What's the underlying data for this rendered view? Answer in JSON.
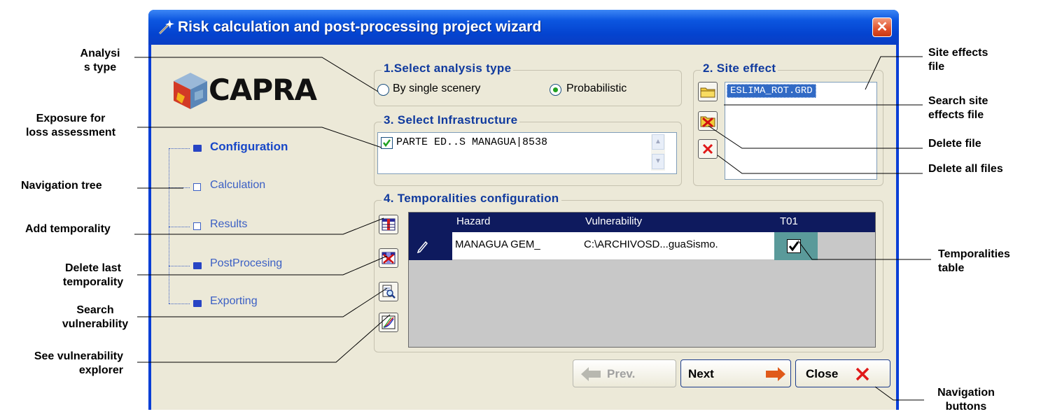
{
  "window": {
    "title": "Risk calculation and post-processing project wizard",
    "close_glyph": "✕"
  },
  "logo": {
    "text": "CAPRA"
  },
  "nav_tree": {
    "items": [
      {
        "label": "Configuration",
        "state": "active"
      },
      {
        "label": "Calculation",
        "state": "empty"
      },
      {
        "label": "Results",
        "state": "empty"
      },
      {
        "label": "PostProcesing",
        "state": "filled"
      },
      {
        "label": "Exporting",
        "state": "filled"
      }
    ]
  },
  "analysis": {
    "legend": "1.Select analysis type",
    "options": [
      {
        "label": "By single scenery",
        "selected": false
      },
      {
        "label": "Probabilistic",
        "selected": true
      }
    ]
  },
  "site_effect": {
    "legend": "2. Site effect",
    "files": [
      "ESLIMA_ROT.GRD"
    ]
  },
  "infrastructure": {
    "legend": "3. Select Infrastructure",
    "items": [
      {
        "label": "PARTE ED..S MANAGUA|8538",
        "checked": true
      }
    ]
  },
  "temporalities": {
    "legend": "4. Temporalities configuration",
    "columns": [
      "Hazard",
      "Vulnerability",
      "T01"
    ],
    "rows": [
      {
        "hazard": "MANAGUA GEM_",
        "vulnerability": "C:\\ARCHIVOSD...guaSismo.",
        "t01": true
      }
    ]
  },
  "nav_buttons": {
    "prev": "Prev.",
    "next": "Next",
    "close": "Close"
  },
  "callouts": {
    "analysis_type": "Analysi\ns type",
    "exposure": "Exposure for\nloss assessment",
    "navigation_tree": "Navigation tree",
    "add_temporality": "Add temporality",
    "delete_last": "Delete last\ntemporality",
    "search_vuln": "Search\nvulnerability",
    "see_explorer": "See vulnerability\nexplorer",
    "site_effects_file": "Site effects\nfile",
    "search_site": "Search site\neffects file",
    "delete_file": "Delete file",
    "delete_all": "Delete all files",
    "temporalities_table": "Temporalities\ntable",
    "navigation_buttons": "Navigation\nbuttons"
  },
  "colors": {
    "titlebar": "#0443cf",
    "client_bg": "#ece9d8",
    "legend_text": "#103a9e",
    "grid_header": "#0e1a5e",
    "close_red": "#e0502a"
  }
}
